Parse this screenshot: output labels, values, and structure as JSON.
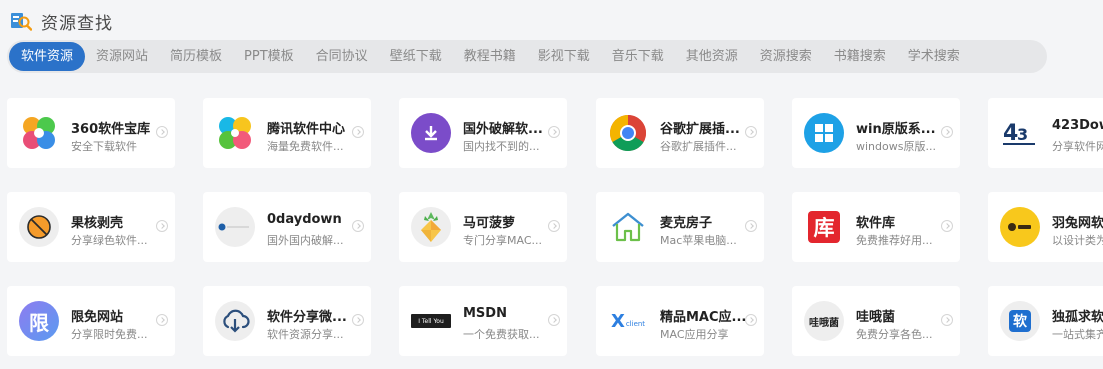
{
  "header": {
    "title": "资源查找",
    "icon": "search-resource-icon"
  },
  "tabs": [
    {
      "label": "软件资源",
      "active": true
    },
    {
      "label": "资源网站"
    },
    {
      "label": "简历模板"
    },
    {
      "label": "PPT模板"
    },
    {
      "label": "合同协议"
    },
    {
      "label": "壁纸下载"
    },
    {
      "label": "教程书籍"
    },
    {
      "label": "影视下载"
    },
    {
      "label": "音乐下载"
    },
    {
      "label": "其他资源"
    },
    {
      "label": "资源搜索"
    },
    {
      "label": "书籍搜索"
    },
    {
      "label": "学术搜索"
    }
  ],
  "colors": {
    "accent": "#2b72c9",
    "background": "#f4f5f7"
  },
  "cards": [
    {
      "name": "360软件宝库",
      "desc": "安全下载软件",
      "icon": "clover-icon"
    },
    {
      "name": "腾讯软件中心",
      "desc": "海量免费软件...",
      "icon": "clover-icon"
    },
    {
      "name": "国外破解软...",
      "desc": "国内找不到的...",
      "icon": "download-icon"
    },
    {
      "name": "谷歌扩展插...",
      "desc": "谷歌扩展插件...",
      "icon": "chrome-icon"
    },
    {
      "name": "win原版系...",
      "desc": "windows原版...",
      "icon": "windows-icon"
    },
    {
      "name": "423Dow",
      "desc": "分享软件网",
      "icon": "logo-423-icon"
    },
    {
      "name": "果核剥壳",
      "desc": "分享绿色软件...",
      "icon": "prohibit-icon"
    },
    {
      "name": "0daydown",
      "desc": "国外国内破解...",
      "icon": "site-logo-icon"
    },
    {
      "name": "马可菠萝",
      "desc": "专门分享MAC...",
      "icon": "pineapple-icon"
    },
    {
      "name": "麦克房子",
      "desc": "Mac苹果电脑...",
      "icon": "house-icon"
    },
    {
      "name": "软件库",
      "desc": "免费推荐好用...",
      "icon": "ku-logo-icon",
      "icon_text": "库"
    },
    {
      "name": "羽兔网软",
      "desc": "以设计类为",
      "icon": "yutu-logo-icon"
    },
    {
      "name": "限免网站",
      "desc": "分享限时免费...",
      "icon": "xian-logo-icon",
      "icon_text": "限"
    },
    {
      "name": "软件分享微...",
      "desc": "软件资源分享...",
      "icon": "cloud-download-icon"
    },
    {
      "name": "MSDN",
      "desc": "一个免费获取...",
      "icon": "msdn-logo-icon",
      "icon_text": "I Tell You"
    },
    {
      "name": "精品MAC应...",
      "desc": "MAC应用分享",
      "icon": "xclient-logo-icon",
      "icon_text": "client"
    },
    {
      "name": "哇哦菌",
      "desc": "免费分享各色...",
      "icon": "waojun-logo-icon",
      "icon_text": "哇哦菌"
    },
    {
      "name": "独孤求软",
      "desc": "一站式集齐",
      "icon": "ruan-logo-icon",
      "icon_text": "软"
    }
  ]
}
